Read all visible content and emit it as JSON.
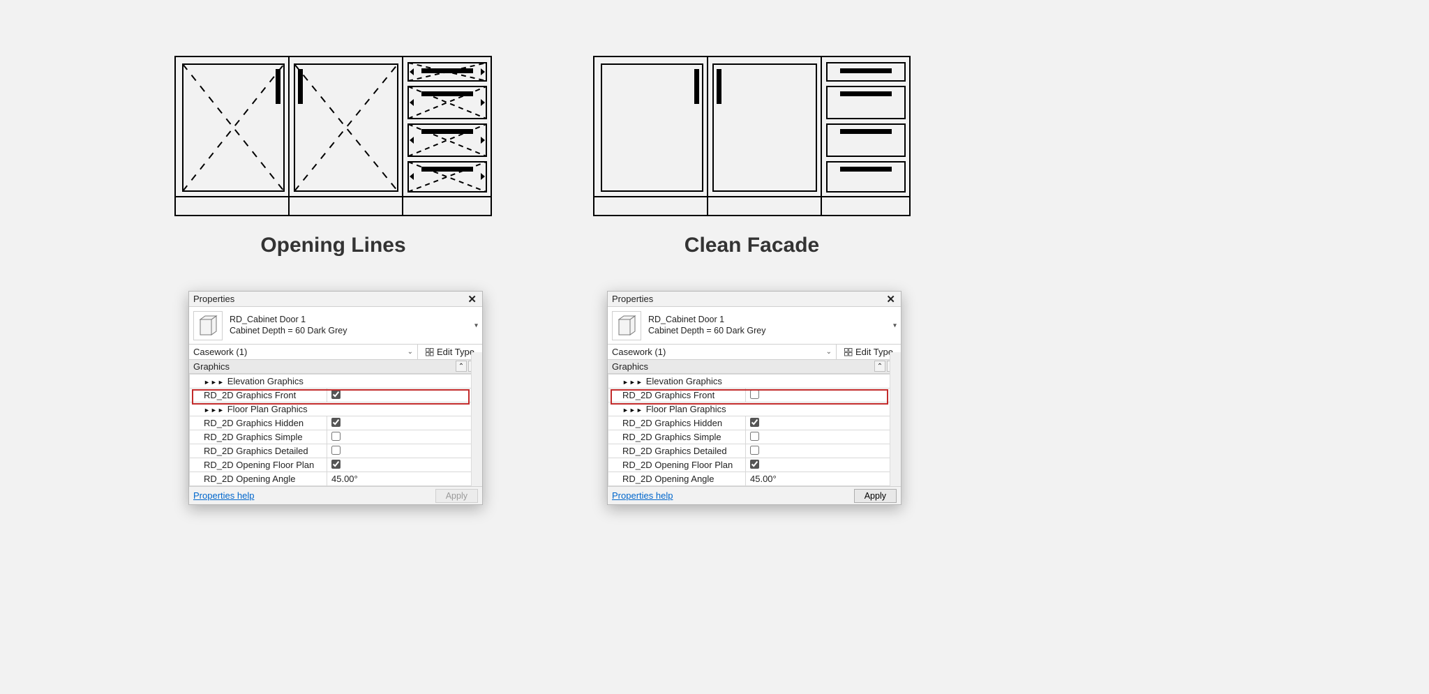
{
  "captions": {
    "left": "Opening Lines",
    "right": "Clean Facade"
  },
  "panel": {
    "title": "Properties",
    "family_name": "RD_Cabinet Door 1",
    "type_name": "Cabinet Depth = 60 Dark Grey",
    "selector": "Casework (1)",
    "edit_type": "Edit Type",
    "section": "Graphics",
    "rows": {
      "elevation_group": "Elevation Graphics",
      "front": "RD_2D Graphics Front",
      "floorplan_group": "Floor Plan Graphics",
      "hidden": "RD_2D Graphics Hidden",
      "simple": "RD_2D Graphics Simple",
      "detailed": "RD_2D Graphics Detailed",
      "opening_fp": "RD_2D Opening Floor Plan",
      "opening_angle": "RD_2D Opening Angle"
    },
    "values_left": {
      "front": true,
      "hidden": true,
      "simple": false,
      "detailed": false,
      "opening_fp": true,
      "opening_angle": "45.00°"
    },
    "values_right": {
      "front": false,
      "hidden": true,
      "simple": false,
      "detailed": false,
      "opening_fp": true,
      "opening_angle": "45.00°"
    },
    "help": "Properties help",
    "apply": "Apply",
    "apply_disabled_left": true,
    "apply_disabled_right": false
  }
}
